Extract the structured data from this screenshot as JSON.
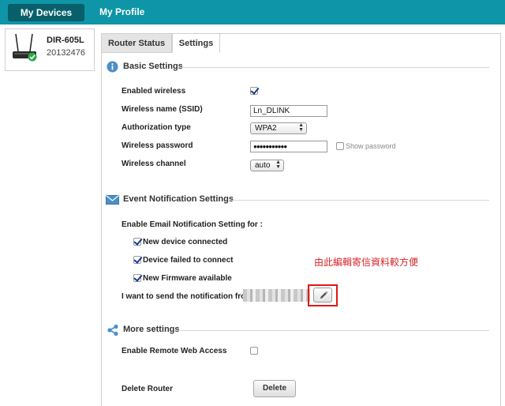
{
  "topbar": {
    "my_devices": "My Devices",
    "my_profile": "My Profile"
  },
  "device": {
    "name": "DIR-605L",
    "serial": "20132476",
    "status_icon": "check-badge-icon"
  },
  "tabs": {
    "router_status": "Router Status",
    "settings": "Settings"
  },
  "basic": {
    "title": "Basic Settings",
    "icon": "info-icon",
    "enabled_wireless_label": "Enabled wireless",
    "enabled_wireless": true,
    "ssid_label": "Wireless name (SSID)",
    "ssid_value": "Ln_DLINK",
    "auth_label": "Authorization type",
    "auth_value": "WPA2",
    "password_label": "Wireless password",
    "password_value": "●●●●●●●●●●●",
    "show_password_label": "Show password",
    "show_password": false,
    "channel_label": "Wireless channel",
    "channel_value": "auto"
  },
  "events": {
    "title": "Event Notification Settings",
    "icon": "envelope-icon",
    "intro": "Enable Email Notification Setting for :",
    "items": [
      {
        "label": "New device connected",
        "checked": true
      },
      {
        "label": "Device failed to connect",
        "checked": true
      },
      {
        "label": "New Firmware available",
        "checked": true
      }
    ],
    "from_label": "I want to send the notification from In",
    "annotation": "由此編輯寄信資料較方便"
  },
  "more": {
    "title": "More settings",
    "icon": "share-icon",
    "remote_label": "Enable Remote Web Access",
    "remote_checked": false,
    "delete_label": "Delete Router",
    "delete_button": "Delete"
  },
  "colors": {
    "topbar": "#0e95a7",
    "active_tab": "#08606d",
    "annotation": "#d8262c",
    "highlight_box": "#e0161a"
  }
}
